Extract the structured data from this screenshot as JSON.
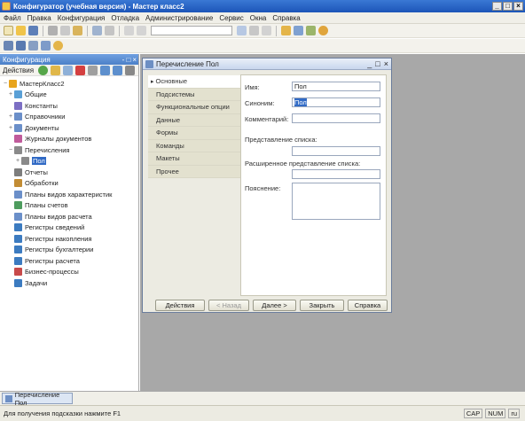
{
  "window": {
    "title": "Конфигуратор (учебная версия) - Мастер класс2",
    "controls": [
      "_",
      "□",
      "×"
    ]
  },
  "menu": [
    "Файл",
    "Правка",
    "Конфигурация",
    "Отладка",
    "Администрирование",
    "Сервис",
    "Окна",
    "Справка"
  ],
  "config_panel": {
    "title": "Конфигурация",
    "controls": [
      "- □",
      "×"
    ],
    "actions_label": "Действия",
    "tree": [
      {
        "label": "МастерКласс2",
        "expander": "−",
        "icon_color": "#e8a41c"
      },
      {
        "label": "Общие",
        "expander": "+",
        "icon_color": "#5aa0d6"
      },
      {
        "label": "Константы",
        "expander": "",
        "icon_color": "#7c6fc4"
      },
      {
        "label": "Справочники",
        "expander": "+",
        "icon_color": "#6b8fc9"
      },
      {
        "label": "Документы",
        "expander": "+",
        "icon_color": "#6b8fc9"
      },
      {
        "label": "Журналы документов",
        "expander": "",
        "icon_color": "#c05b9b"
      },
      {
        "label": "Перечисления",
        "expander": "−",
        "icon_color": "#8a8a8a"
      },
      {
        "label": "Пол",
        "expander": "+",
        "icon_color": "#8a8a8a",
        "selected": true
      },
      {
        "label": "Отчеты",
        "expander": "",
        "icon_color": "#7d7d7d"
      },
      {
        "label": "Обработки",
        "expander": "",
        "icon_color": "#c28c34"
      },
      {
        "label": "Планы видов характеристик",
        "expander": "",
        "icon_color": "#6b8fc9"
      },
      {
        "label": "Планы счетов",
        "expander": "",
        "icon_color": "#4e9c5e"
      },
      {
        "label": "Планы видов расчета",
        "expander": "",
        "icon_color": "#6b8fc9"
      },
      {
        "label": "Регистры сведений",
        "expander": "",
        "icon_color": "#3c7bc0"
      },
      {
        "label": "Регистры накопления",
        "expander": "",
        "icon_color": "#3c7bc0"
      },
      {
        "label": "Регистры бухгалтерии",
        "expander": "",
        "icon_color": "#3c7bc0"
      },
      {
        "label": "Регистры расчета",
        "expander": "",
        "icon_color": "#3c7bc0"
      },
      {
        "label": "Бизнес-процессы",
        "expander": "",
        "icon_color": "#c84a4a"
      },
      {
        "label": "Задачи",
        "expander": "",
        "icon_color": "#3c7bc0"
      }
    ]
  },
  "dialog": {
    "title": "Перечисление Пол",
    "controls": [
      "_",
      "□",
      "×"
    ],
    "tabs": [
      "Основные",
      "Подсистемы",
      "Функциональные опции",
      "Данные",
      "Формы",
      "Команды",
      "Макеты",
      "Прочее"
    ],
    "active_tab_index": 0,
    "fields": {
      "name_label": "Имя:",
      "name_value": "Пол",
      "synonym_label": "Синоним:",
      "synonym_value": "Пол",
      "comment_label": "Комментарий:",
      "comment_value": "",
      "list_presentation_label": "Представление списка:",
      "list_presentation_value": "",
      "extended_list_presentation_label": "Расширенное представление списка:",
      "extended_list_presentation_value": "",
      "explanation_label": "Пояснение:",
      "explanation_value": ""
    },
    "buttons": {
      "actions": "Действия",
      "back": "< Назад",
      "next": "Далее >",
      "close": "Закрыть",
      "help": "Справка"
    }
  },
  "taskbar": {
    "item_label": "Перечисление Пол"
  },
  "statusbar": {
    "hint": "Для получения подсказки нажмите F1",
    "indicators": [
      "CAP",
      "NUM",
      "ru"
    ]
  }
}
